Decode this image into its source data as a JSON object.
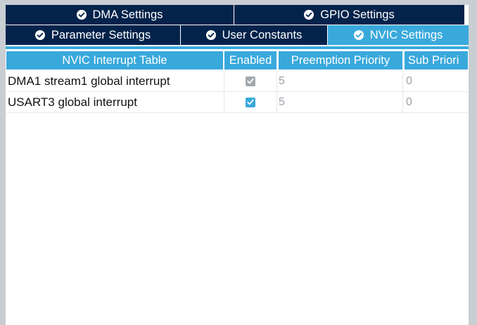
{
  "colors": {
    "tab_inactive": "#03234b",
    "tab_active": "#39a9dc",
    "header": "#39a9dc",
    "checkbox_enabled": "#39a9dc",
    "checkbox_disabled": "#a3a9ae",
    "value_text": "#9ba3ab"
  },
  "tabs": {
    "row1": [
      {
        "label": "DMA Settings",
        "icon": "check-circle-icon"
      },
      {
        "label": "GPIO Settings",
        "icon": "check-circle-icon"
      }
    ],
    "row2": [
      {
        "label": "Parameter Settings",
        "icon": "check-circle-icon"
      },
      {
        "label": "User Constants",
        "icon": "check-circle-icon"
      },
      {
        "label": "NVIC Settings",
        "icon": "check-circle-icon",
        "active": true
      }
    ]
  },
  "table": {
    "headers": [
      "NVIC Interrupt Table",
      "Enabled",
      "Preemption Priority",
      "Sub Priori"
    ],
    "rows": [
      {
        "name": "DMA1 stream1 global interrupt",
        "enabled": true,
        "editable": false,
        "preemption": "5",
        "sub": "0"
      },
      {
        "name": "USART3 global interrupt",
        "enabled": true,
        "editable": true,
        "preemption": "5",
        "sub": "0"
      }
    ]
  }
}
